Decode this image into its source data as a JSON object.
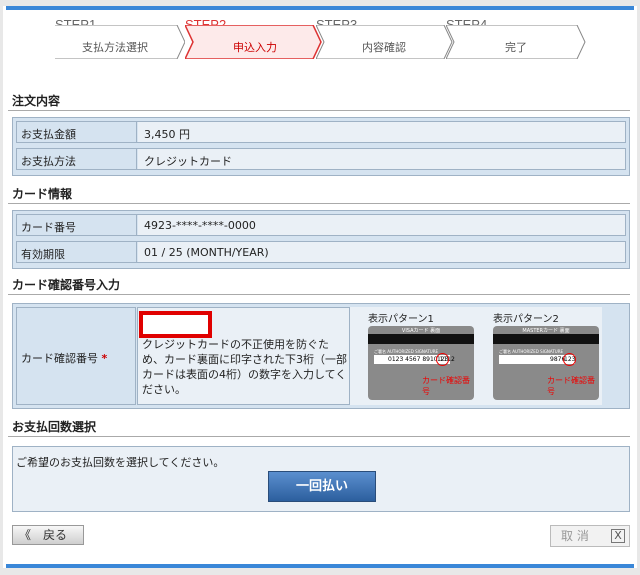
{
  "steps": [
    {
      "head": "STEP1",
      "label": "支払方法選択",
      "active": false
    },
    {
      "head": "STEP2",
      "label": "申込入力",
      "active": true
    },
    {
      "head": "STEP3",
      "label": "内容確認",
      "active": false
    },
    {
      "head": "STEP4",
      "label": "完了",
      "active": false
    }
  ],
  "order": {
    "title": "注文内容",
    "rows": [
      {
        "label": "お支払金額",
        "value": "3,450 円"
      },
      {
        "label": "お支払方法",
        "value": "クレジットカード"
      }
    ]
  },
  "card_info": {
    "title": "カード情報",
    "rows": [
      {
        "label": "カード番号",
        "value": "4923-****-****-0000"
      },
      {
        "label": "有効期限",
        "value": "01 / 25 (MONTH/YEAR)"
      }
    ]
  },
  "cvv": {
    "title": "カード確認番号入力",
    "label": "カード確認番号",
    "required_mark": "*",
    "input_value": "",
    "help": "クレジットカードの不正使用を防ぐため、カード裏面に印字された下3桁（一部カードは表面の4桁）の数字を入力してください。",
    "pattern1_title": "表示パターン1",
    "pattern2_title": "表示パターン2",
    "card1_caption": "VISAカード 裏面",
    "card2_caption": "MASTERカード 裏面",
    "sig_text": "ご署名 AUTHORIZED SIGNATURE",
    "card1_number": "0123 4567 8910 1112",
    "card1_cvv": "123",
    "card2_number": "9876",
    "card2_cvv": "123",
    "cvv_label": "カード確認番号"
  },
  "installments": {
    "title": "お支払回数選択",
    "instruction": "ご希望のお支払回数を選択してください。",
    "button_label": "一回払い"
  },
  "nav": {
    "back_label": "《　戻る",
    "cancel_label": "取 消",
    "cancel_x": "X"
  },
  "colors": {
    "accent_blue": "#3a87d8",
    "active_step": "#d33333",
    "table_label_bg": "#d5e3f0",
    "table_value_bg": "#eaf0f6",
    "highlight_red": "#e00000"
  }
}
